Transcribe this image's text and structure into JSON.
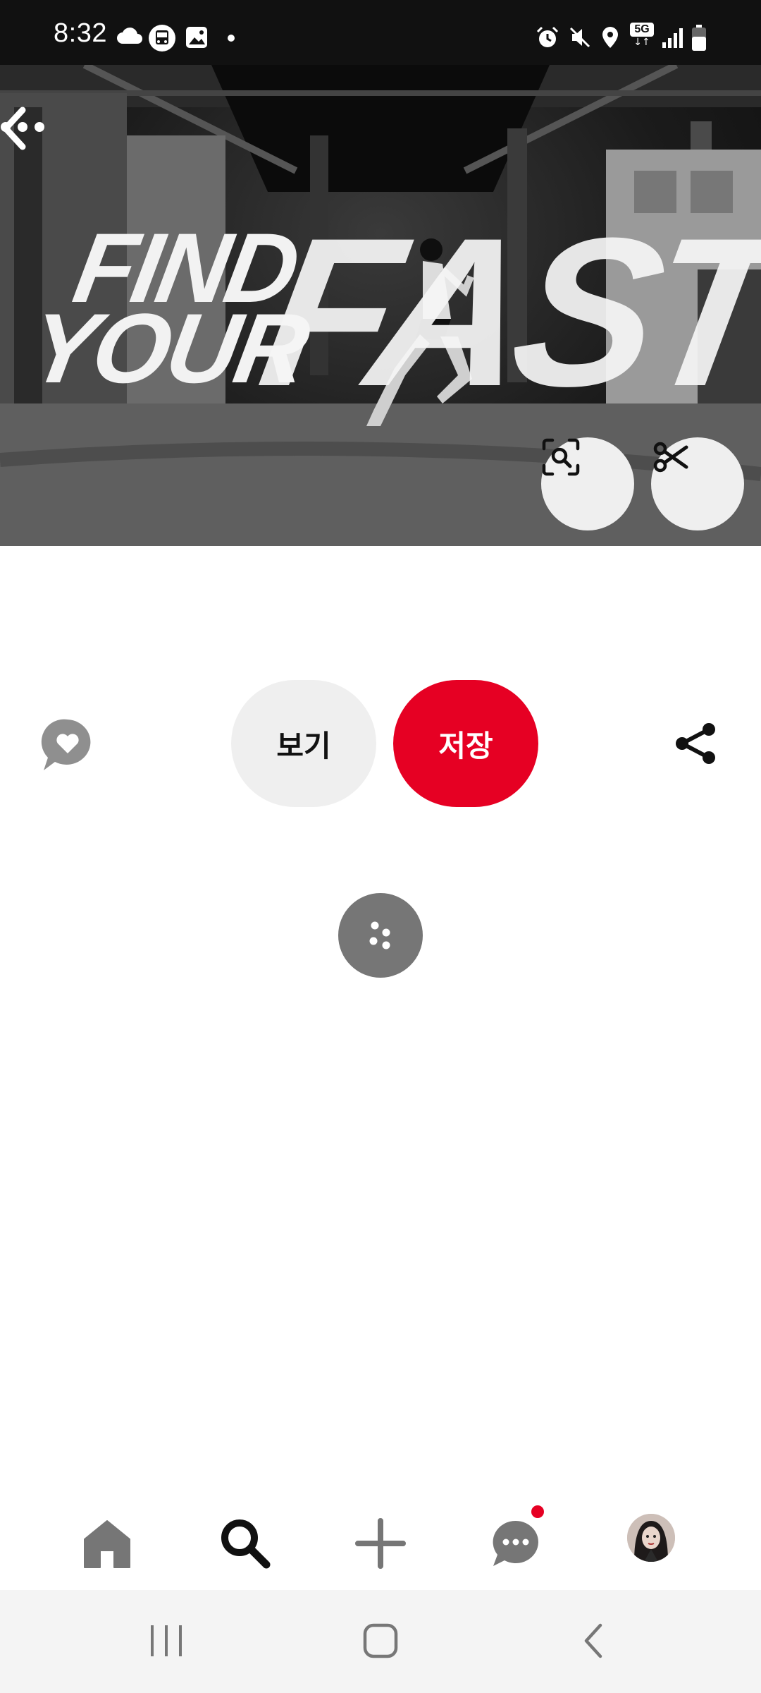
{
  "status_bar": {
    "time": "8:32",
    "left_icons": [
      "cloud-icon",
      "bus-icon",
      "gallery-icon",
      "dot-icon"
    ],
    "right_icons": [
      "alarm-icon",
      "mute-icon",
      "location-icon",
      "5g-icon",
      "signal-icon",
      "battery-icon"
    ],
    "network_label": "5G"
  },
  "hero": {
    "image_text_line1": "FIND",
    "image_text_line2": "YOUR",
    "image_text_big": "FAST",
    "back_icon": "chevron-left-icon",
    "more_icon": "more-horizontal-icon",
    "visual_search_icon": "visual-search-icon",
    "crop_icon": "scissors-icon"
  },
  "actions": {
    "view_label": "보기",
    "save_label": "저장",
    "reaction_icon": "heart-bubble-icon",
    "share_icon": "share-icon",
    "more_ideas_icon": "dots-icon"
  },
  "bottom_nav": {
    "items": [
      "home-icon",
      "search-icon",
      "plus-icon",
      "message-icon",
      "profile-avatar"
    ],
    "active": "search-icon",
    "notification_color": "#e60023"
  },
  "system_nav": {
    "buttons": [
      "recents-icon",
      "home-button-icon",
      "back-icon"
    ]
  },
  "colors": {
    "accent": "#e60023",
    "pill_gray": "#efefef",
    "icon_gray": "#767676"
  }
}
